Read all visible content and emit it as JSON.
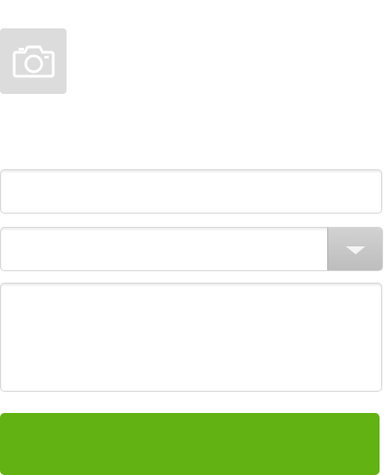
{
  "photo": {
    "icon": "camera-icon"
  },
  "form": {
    "name_value": "",
    "name_placeholder": "",
    "select_value": "",
    "notes_value": "",
    "notes_placeholder": "",
    "submit_label": ""
  },
  "colors": {
    "submit_button": "#63b213",
    "photo_tile": "#dcdcdc",
    "dropdown_button": "#c8c8c8"
  }
}
